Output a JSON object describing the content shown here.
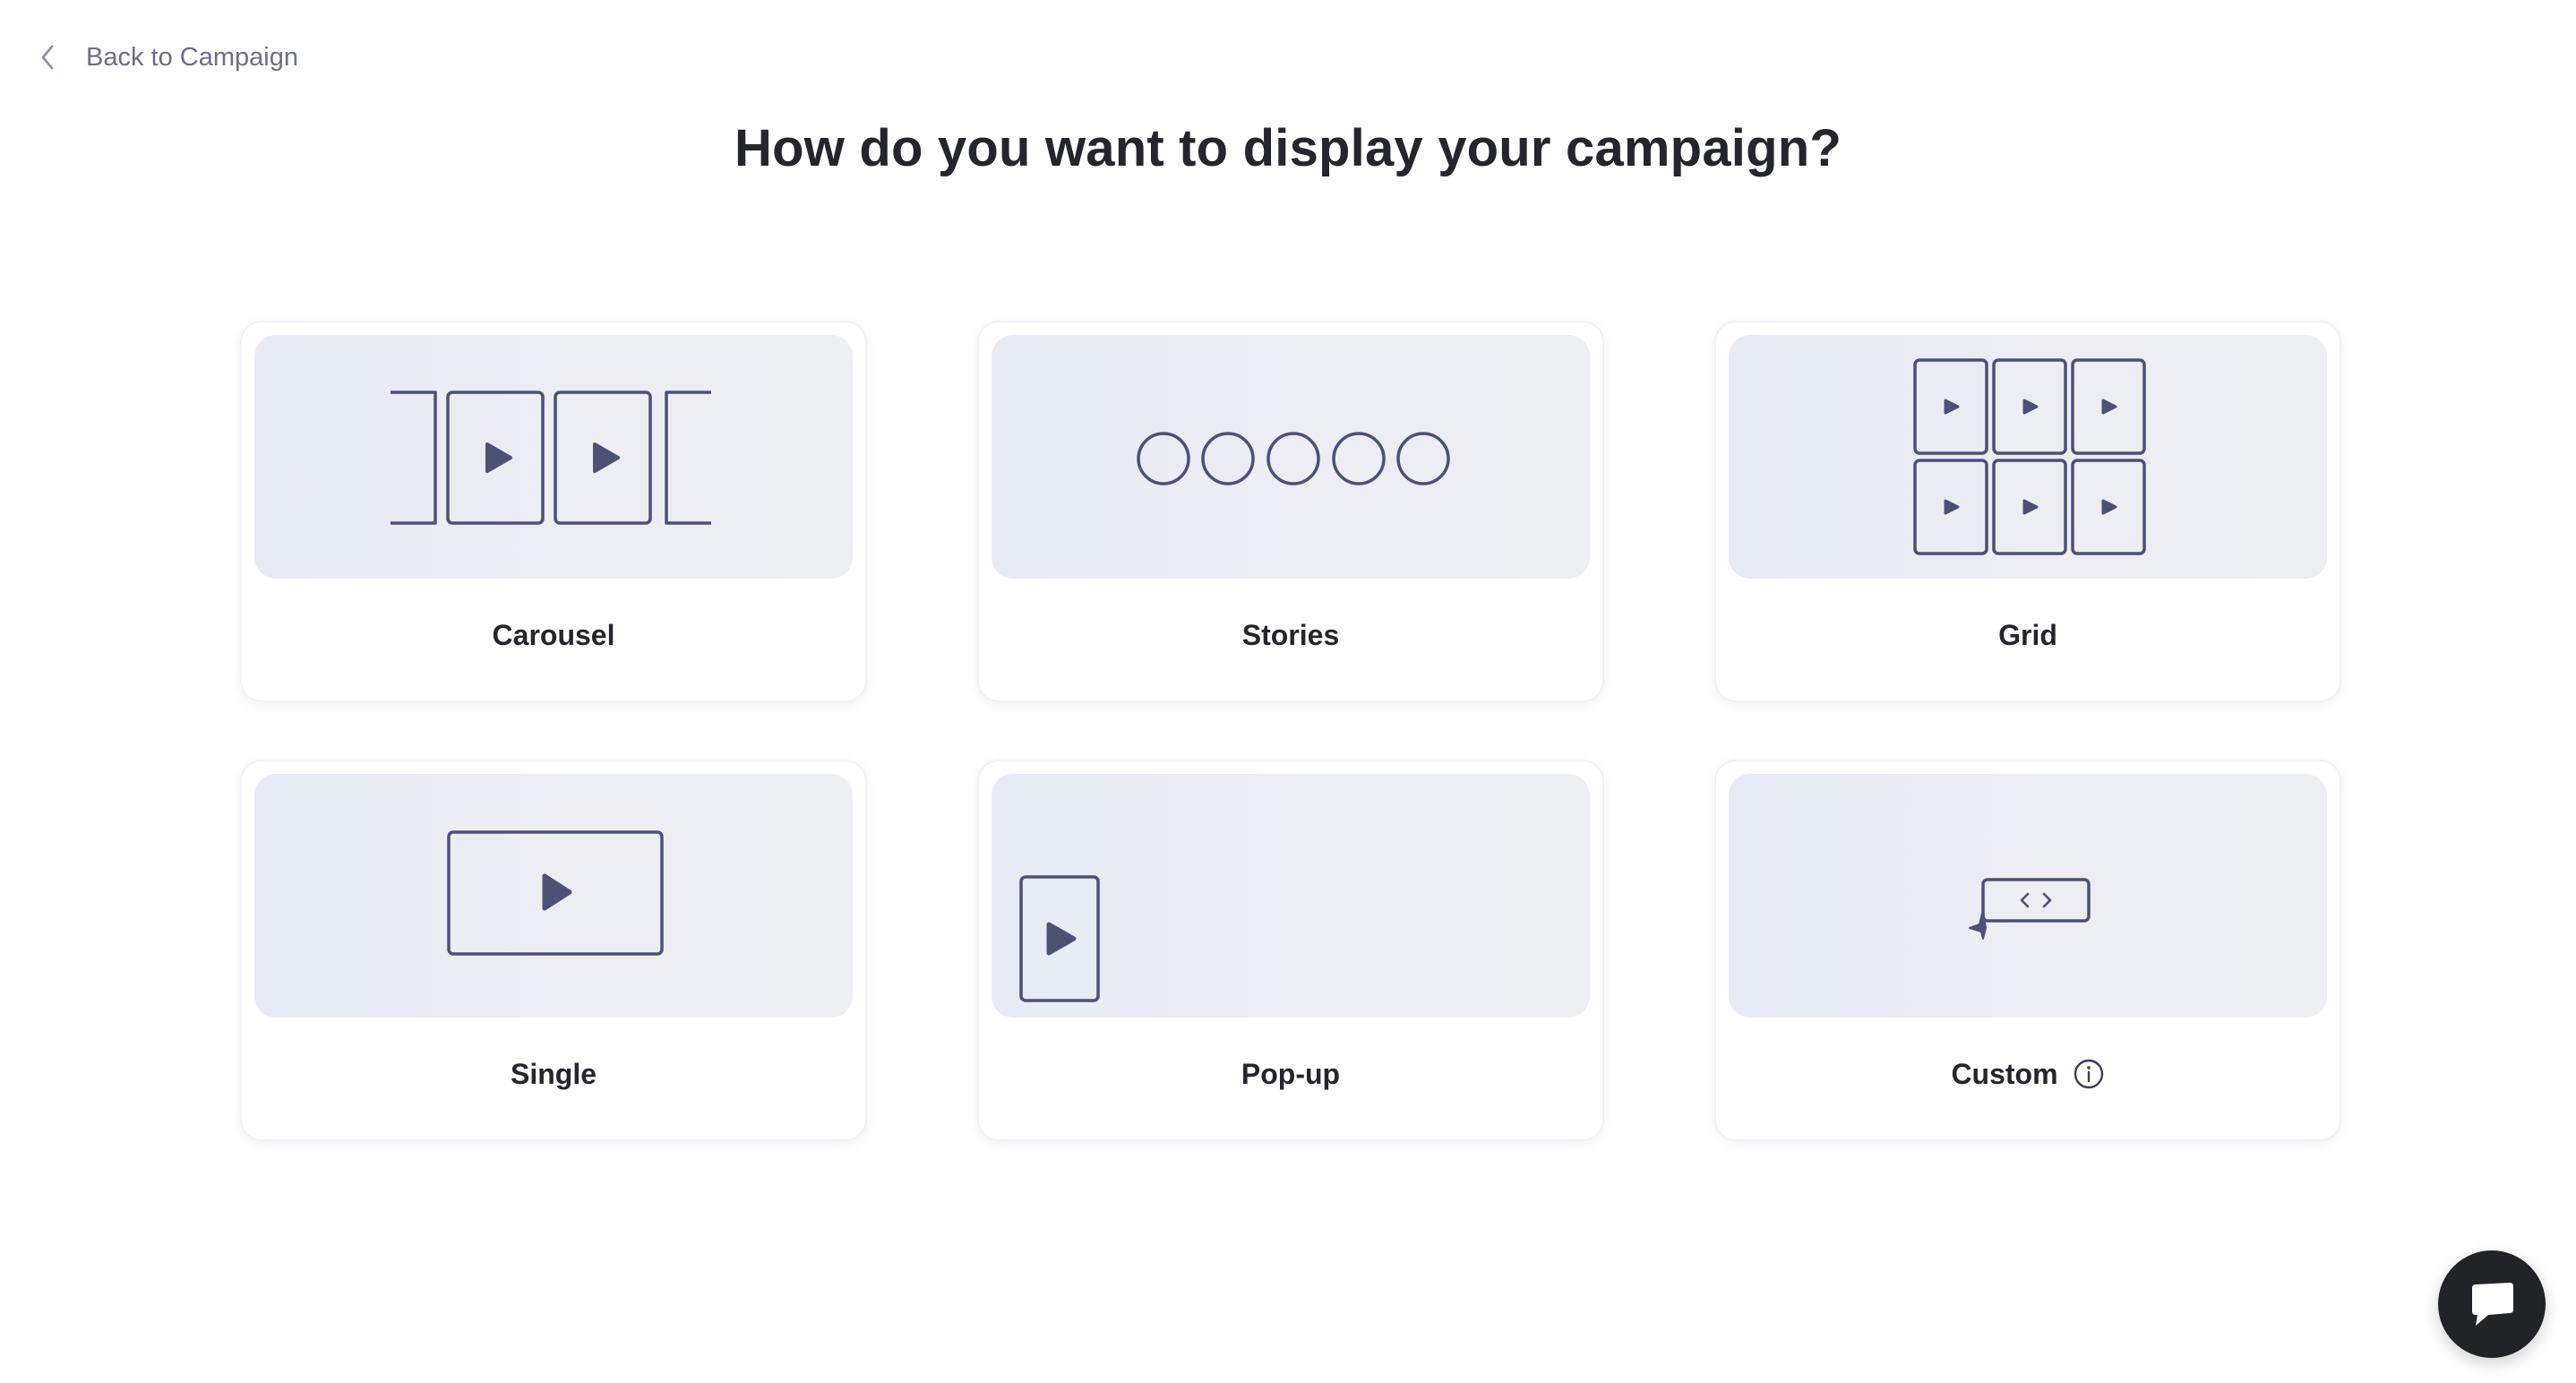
{
  "nav": {
    "back_label": "Back to Campaign"
  },
  "page": {
    "title": "How do you want to display your campaign?"
  },
  "options": [
    {
      "label": "Carousel",
      "icon": "carousel-icon"
    },
    {
      "label": "Stories",
      "icon": "stories-icon"
    },
    {
      "label": "Grid",
      "icon": "grid-icon"
    },
    {
      "label": "Single",
      "icon": "single-video-icon"
    },
    {
      "label": "Pop-up",
      "icon": "popup-icon"
    },
    {
      "label": "Custom",
      "icon": "custom-embed-icon",
      "info_icon": "info-icon"
    }
  ],
  "chat": {
    "icon": "chat-bubble-icon"
  },
  "colors": {
    "text": "#25262b",
    "muted": "#6b6f86",
    "icon_stroke": "#4c5175",
    "preview_bg": "#e9ecf4",
    "chat_bg": "#222327"
  }
}
